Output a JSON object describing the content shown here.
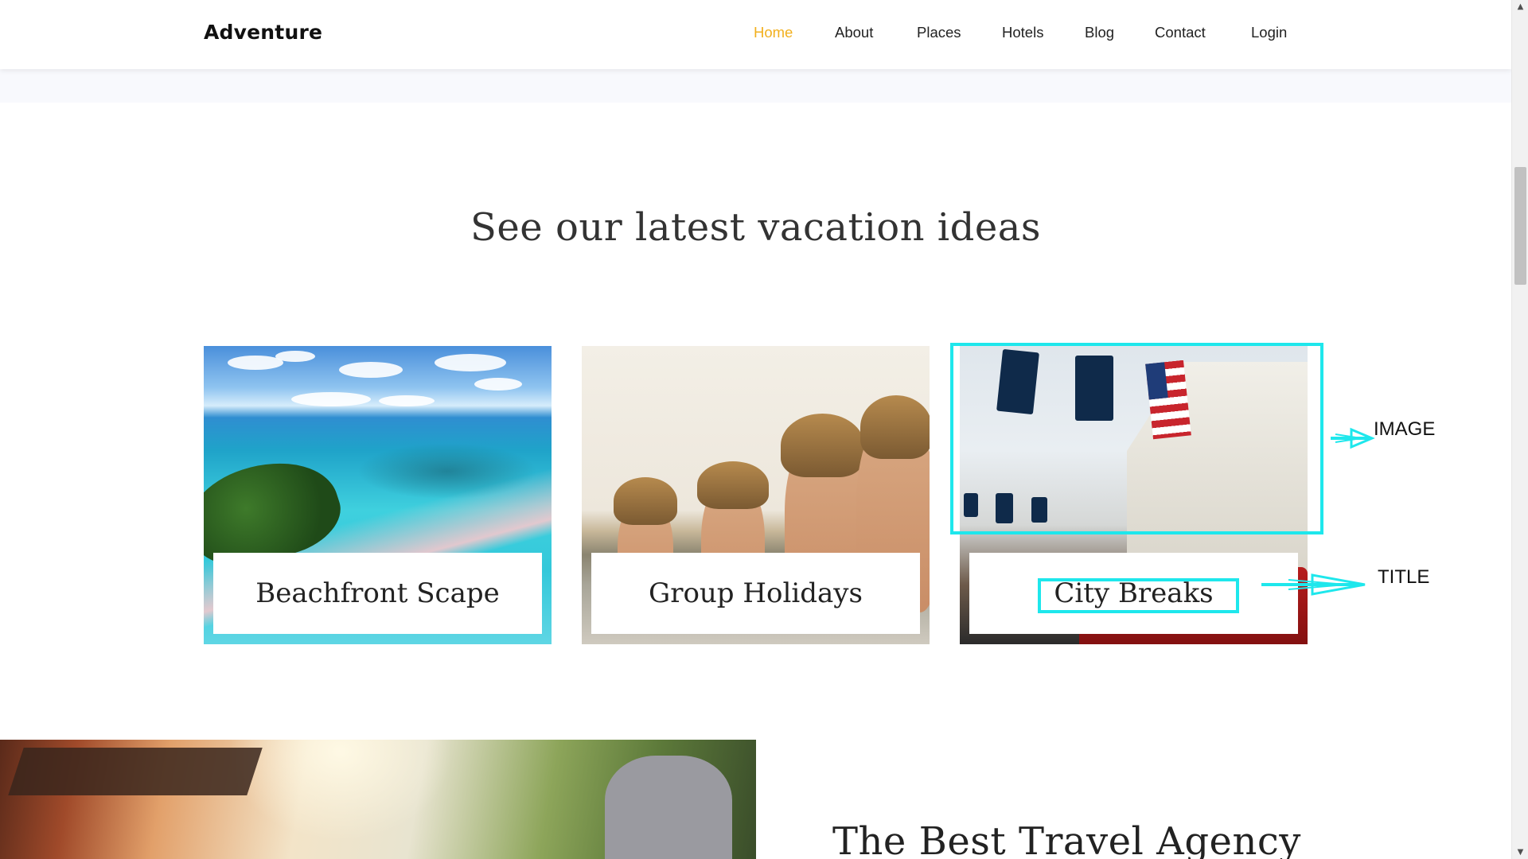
{
  "navbar": {
    "brand": "Adventure",
    "items": [
      {
        "label": "Home",
        "active": true
      },
      {
        "label": "About",
        "active": false
      },
      {
        "label": "Places",
        "active": false
      },
      {
        "label": "Hotels",
        "active": false
      },
      {
        "label": "Blog",
        "active": false
      },
      {
        "label": "Contact",
        "active": false
      },
      {
        "label": "Login",
        "active": false
      }
    ],
    "active_color": "#f2b01e"
  },
  "section": {
    "title": "See our latest vacation ideas",
    "cards": [
      {
        "title": "Beachfront Scape"
      },
      {
        "title": "Group Holidays"
      },
      {
        "title": "City Breaks"
      }
    ]
  },
  "annotations": {
    "image_label": "IMAGE",
    "title_label": "TITLE",
    "color": "#1ee7ec"
  },
  "about": {
    "title": "The Best Travel Agency"
  },
  "scrollbar": {
    "up_icon": "triangle-up-icon",
    "down_icon": "triangle-down-icon"
  }
}
